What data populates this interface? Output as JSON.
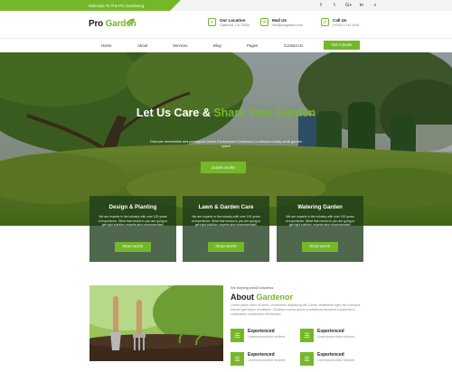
{
  "topbar": {
    "welcome": "Welcome To The Pro Gardening",
    "socials": [
      {
        "icon": "facebook-icon",
        "glyph": "f"
      },
      {
        "icon": "twitter-icon",
        "glyph": "t"
      },
      {
        "icon": "google-plus-icon",
        "glyph": "G+"
      },
      {
        "icon": "instagram-icon",
        "glyph": "in"
      },
      {
        "icon": "search-icon",
        "glyph": "⌕"
      }
    ]
  },
  "header": {
    "logo_pro": "Pro",
    "logo_garden": "Garden",
    "location": {
      "title": "Our Location",
      "value": "California, CA 70300",
      "glyph": "⌖"
    },
    "mail": {
      "title": "Mail Us",
      "value": "Info@progarden.com",
      "glyph": "✉"
    },
    "call": {
      "title": "Call Us",
      "value": "(+012) 0 111 1234",
      "glyph": "✆"
    }
  },
  "nav": {
    "items": [
      "Home",
      "About",
      "Services",
      "Blog",
      "Pages",
      "Contact Us"
    ],
    "quote": "Get A Quote"
  },
  "hero": {
    "title_a": "Let Us Care & ",
    "title_b": "Share Your Garden",
    "subtitle": "Discover remarkable and prestigious Green Environment Gardeners to enhance lovely small garden space",
    "button": "LEARN MORE"
  },
  "services": [
    {
      "title": "Design & Planting",
      "text": "We are experts in the industry with over 100 years of experience. What that means is you are going to get right solution, experts also recommended.",
      "button": "READ MORE"
    },
    {
      "title": "Lawn & Garden Care",
      "text": "We are experts in the industry with over 100 years of experience. What that means is you are going to get right solution, experts also recommended.",
      "button": "READ MORE"
    },
    {
      "title": "Watering Garden",
      "text": "We are experts in the industry with over 100 years of experience. What that means is you are going to get right solution, experts also recommended.",
      "button": "READ MORE"
    }
  ],
  "about": {
    "small": "We helping small business",
    "title_a": "About ",
    "title_b": "Gardenor",
    "text": "Lorem ipsum dolor sit amet, consectetur adipiscing elit. Donec vestibulum eget nisl in tempor. Mauris eget turpis ut tristique. Curabitur rutrum ipsum a sollicitudin tincidunt in placerat in, consectetur consectetur elementum.",
    "features": [
      {
        "title": "Experienced",
        "text": "Lorem ipsum dolor sit Amet."
      },
      {
        "title": "Experienced",
        "text": "Lorem ipsum dolor sit Amet."
      },
      {
        "title": "Experienced",
        "text": "Lorem ipsum dolor sit Amet."
      },
      {
        "title": "Experienced",
        "text": "Lorem ipsum dolor sit Amet."
      }
    ]
  },
  "colors": {
    "accent": "#74b82a",
    "dark": "#1d1d1d"
  }
}
